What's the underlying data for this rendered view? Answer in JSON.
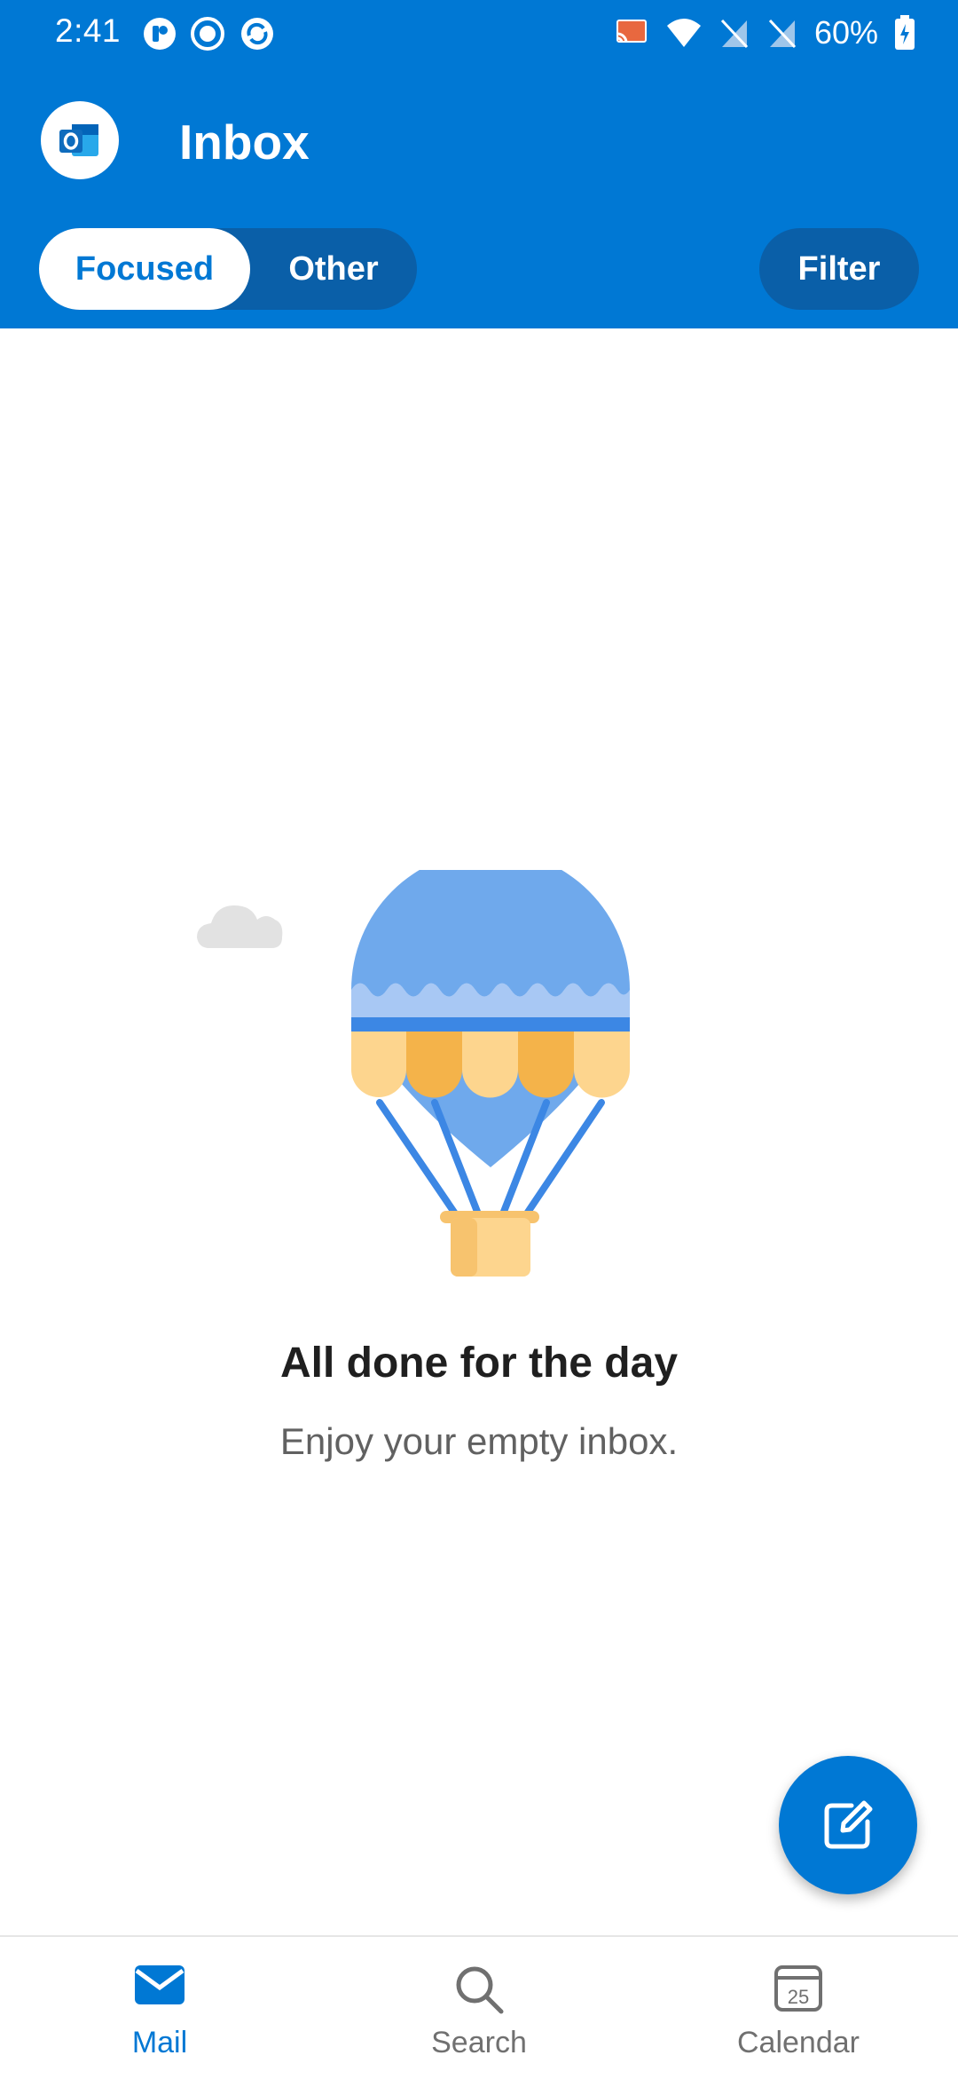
{
  "status_bar": {
    "time": "2:41",
    "battery": "60%",
    "icons_left": [
      "notification-app-icon",
      "record-icon",
      "sync-app-icon"
    ],
    "icons_right": [
      "cast-icon",
      "wifi-icon",
      "no-sim-icon",
      "no-sim-icon",
      "battery-charging-icon"
    ]
  },
  "header": {
    "title": "Inbox",
    "app_icon": "outlook-logo-icon",
    "tabs": [
      {
        "label": "Focused",
        "selected": true
      },
      {
        "label": "Other",
        "selected": false
      }
    ],
    "filter_label": "Filter"
  },
  "empty_state": {
    "illustration": "hot-air-balloon",
    "title": "All done for the day",
    "subtitle": "Enjoy your empty inbox."
  },
  "fab": {
    "icon": "compose-icon"
  },
  "bottom_nav": {
    "items": [
      {
        "label": "Mail",
        "icon": "mail-icon",
        "active": true
      },
      {
        "label": "Search",
        "icon": "search-icon",
        "active": false
      },
      {
        "label": "Calendar",
        "icon": "calendar-icon",
        "active": false
      }
    ],
    "calendar_day": "25"
  },
  "colors": {
    "brand": "#0078d4",
    "segment_bg": "#0a5fa8",
    "text_primary": "#1f1f1f",
    "text_secondary": "#616161"
  }
}
